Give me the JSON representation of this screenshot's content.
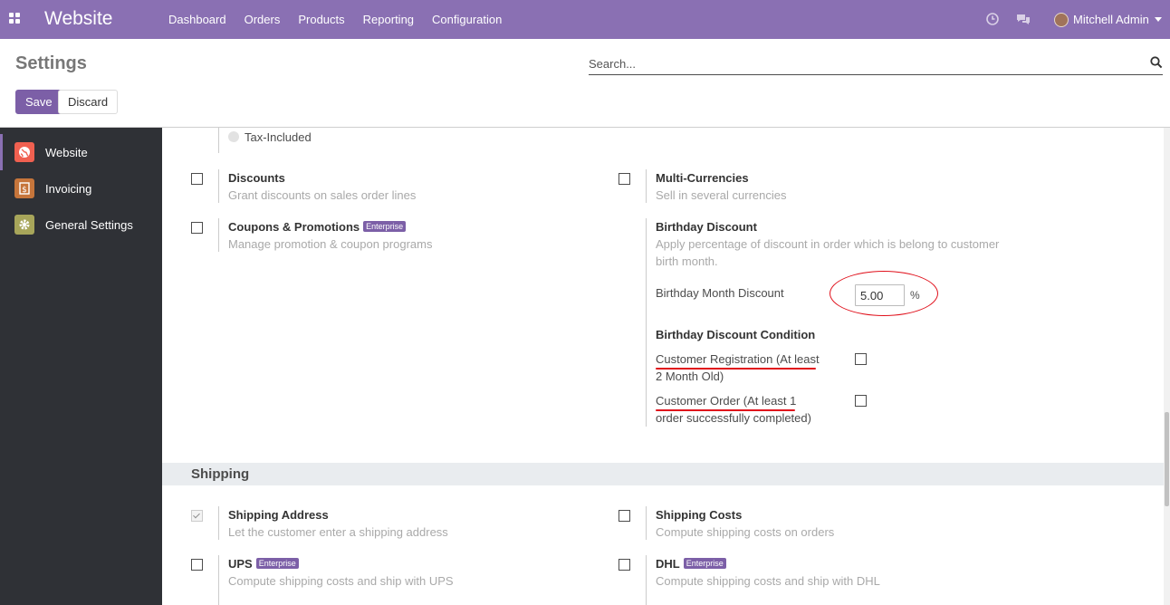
{
  "navbar": {
    "brand": "Website",
    "menu": [
      "Dashboard",
      "Orders",
      "Products",
      "Reporting",
      "Configuration"
    ],
    "user_name": "Mitchell Admin"
  },
  "control_panel": {
    "title": "Settings",
    "search_placeholder": "Search...",
    "save_label": "Save",
    "discard_label": "Discard"
  },
  "sidebar": {
    "items": [
      {
        "label": "Website",
        "icon": "website-globe-icon",
        "color": "#f06050",
        "active": true
      },
      {
        "label": "Invoicing",
        "icon": "invoice-icon",
        "color": "#c6753b",
        "active": false
      },
      {
        "label": "General Settings",
        "icon": "gear-icon",
        "color": "#a7a55a",
        "active": false
      }
    ]
  },
  "pricing": {
    "tax_included_label": "Tax-Included"
  },
  "settings": {
    "discounts": {
      "label": "Discounts",
      "desc": "Grant discounts on sales order lines",
      "checked": false
    },
    "multi_currencies": {
      "label": "Multi-Currencies",
      "desc": "Sell in several currencies",
      "checked": false
    },
    "coupons": {
      "label": "Coupons & Promotions",
      "badge": "Enterprise",
      "desc": "Manage promotion & coupon programs",
      "checked": false
    },
    "birthday": {
      "label": "Birthday Discount",
      "desc_line1": "Apply percentage of discount in order which is belong to customer",
      "desc_line2": "birth month.",
      "month_discount_label": "Birthday Month Discount",
      "month_discount_value": "5.00",
      "percent_sign": "%",
      "condition_title": "Birthday Discount Condition",
      "cond_registration_line1": "Customer Registration (At least",
      "cond_registration_line2": "2 Month Old)",
      "cond_order_line1": "Customer Order (At least 1",
      "cond_order_line2": "order successfully completed)",
      "cond_registration_checked": false,
      "cond_order_checked": false
    }
  },
  "shipping": {
    "section_title": "Shipping",
    "shipping_address": {
      "label": "Shipping Address",
      "desc": "Let the customer enter a shipping address",
      "checked": true
    },
    "shipping_costs": {
      "label": "Shipping Costs",
      "desc": "Compute shipping costs on orders",
      "checked": false
    },
    "ups": {
      "label": "UPS",
      "badge": "Enterprise",
      "desc": "Compute shipping costs and ship with UPS",
      "checked": false
    },
    "dhl": {
      "label": "DHL",
      "badge": "Enterprise",
      "desc": "Compute shipping costs and ship with DHL",
      "checked": false
    }
  },
  "colors": {
    "navbar": "#8a70b3",
    "primary_button": "#7c5fa7",
    "sidebar_bg": "#2f3136",
    "annotation_red": "#e0101b"
  }
}
